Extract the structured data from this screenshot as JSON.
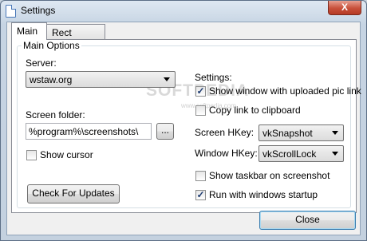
{
  "window": {
    "title": "Settings",
    "close_glyph": "X",
    "icon": "document-icon"
  },
  "tabs": [
    {
      "label": "Main",
      "active": true
    },
    {
      "label": "Rect Capture",
      "active": false
    }
  ],
  "main": {
    "group_title": "Main Options",
    "server": {
      "label": "Server:",
      "value": "wstaw.org"
    },
    "screen_folder": {
      "label": "Screen folder:",
      "value": "%program%\\screenshots\\",
      "browse_label": "..."
    },
    "show_cursor": {
      "label": "Show cursor",
      "checked": false
    },
    "check_updates_label": "Check For Updates",
    "settings": {
      "label": "Settings:",
      "show_window": {
        "label": "Show window with uploaded pic link",
        "checked": true
      },
      "copy_link": {
        "label": "Copy link to clipboard",
        "checked": false
      },
      "screen_hkey": {
        "label": "Screen HKey:",
        "value": "vkSnapshot"
      },
      "window_hkey": {
        "label": "Window HKey:",
        "value": "vkScrollLock"
      },
      "show_taskbar": {
        "label": "Show taskbar on screenshot",
        "checked": false
      },
      "run_startup": {
        "label": "Run with windows startup",
        "checked": true
      }
    }
  },
  "watermark": {
    "text": "SOFTPEDIA",
    "sub": "www.softpedia.com"
  },
  "footer": {
    "close_label": "Close"
  },
  "colors": {
    "accent": "#3c7fb1",
    "title_close": "#c8503a"
  }
}
